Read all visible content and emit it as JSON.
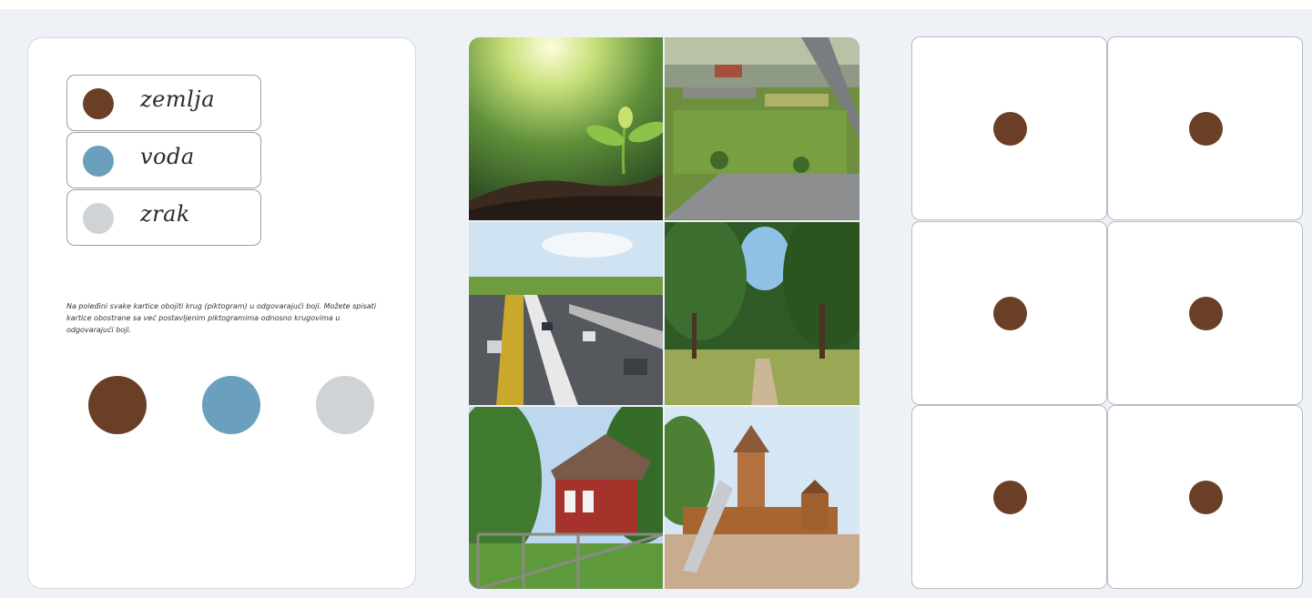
{
  "legend": {
    "items": [
      {
        "word": "zemlja",
        "color": "#6b3f26",
        "dot_icon": "brown-circle-icon"
      },
      {
        "word": "voda",
        "color": "#6a9fbe",
        "dot_icon": "blue-circle-icon"
      },
      {
        "word": "zrak",
        "color": "#cfd3d6",
        "dot_icon": "gray-circle-icon"
      }
    ]
  },
  "instructions": "Na poleđini svake kartice obojiti krug (piktogram) u odgovarajući boji. Možete spisati kartice obostrane sa već postavljenim piktogramima odnosno krugovima u odgovarajući boji.",
  "colors": {
    "earth": "#6b3f26",
    "water": "#6a9fbe",
    "air": "#cfd3d6",
    "panel_border": "#d3d7dc",
    "background": "#eef2f6"
  },
  "photos": [
    {
      "subject": "sprout-in-soil-photo"
    },
    {
      "subject": "aerial-fields-and-town-photo"
    },
    {
      "subject": "highway-traffic-photo"
    },
    {
      "subject": "forest-path-photo"
    },
    {
      "subject": "red-house-with-gate-photo"
    },
    {
      "subject": "wooden-playground-photo"
    }
  ],
  "cards": {
    "dot_color": "#6b3f26",
    "count": 6
  }
}
